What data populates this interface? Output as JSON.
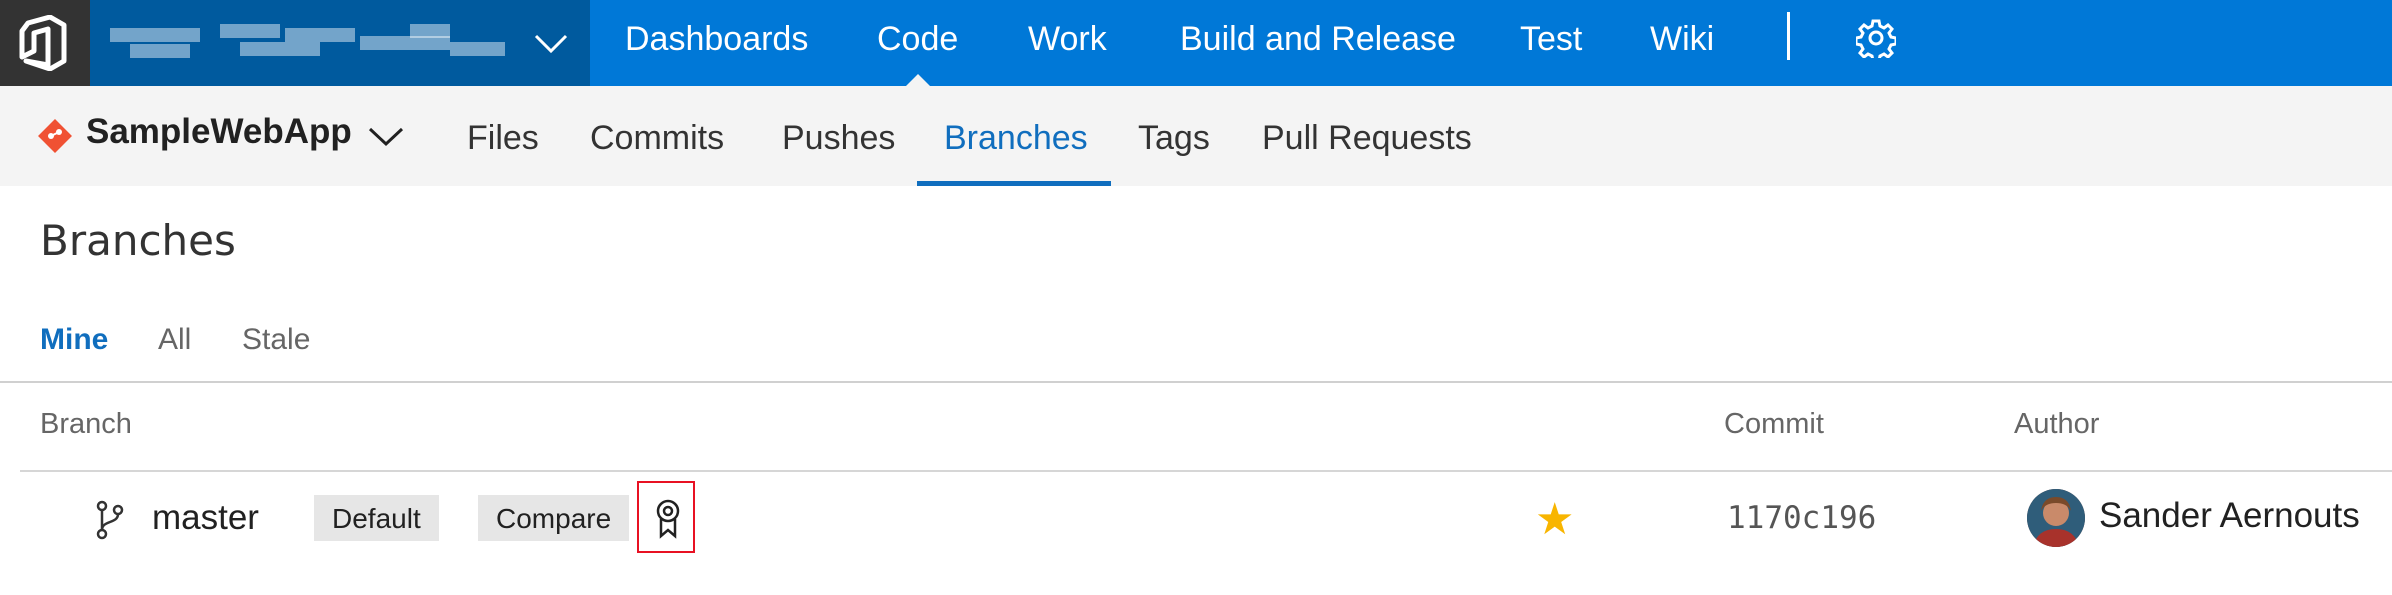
{
  "top_nav": {
    "account_name": "",
    "items": [
      {
        "label": "Dashboards",
        "active": false
      },
      {
        "label": "Code",
        "active": true
      },
      {
        "label": "Work",
        "active": false
      },
      {
        "label": "Build and Release",
        "active": false
      },
      {
        "label": "Test",
        "active": false
      },
      {
        "label": "Wiki",
        "active": false
      }
    ],
    "icons": [
      "vsts-logo-icon",
      "chevron-down-icon",
      "gear-icon"
    ]
  },
  "repo": {
    "name": "SampleWebApp",
    "icon": "git-repo-icon"
  },
  "sub_nav": {
    "tabs": [
      {
        "label": "Files",
        "active": false
      },
      {
        "label": "Commits",
        "active": false
      },
      {
        "label": "Pushes",
        "active": false
      },
      {
        "label": "Branches",
        "active": true
      },
      {
        "label": "Tags",
        "active": false
      },
      {
        "label": "Pull Requests",
        "active": false
      }
    ]
  },
  "page": {
    "title": "Branches",
    "filters": [
      {
        "label": "Mine",
        "active": true
      },
      {
        "label": "All",
        "active": false
      },
      {
        "label": "Stale",
        "active": false
      }
    ],
    "columns": {
      "branch": "Branch",
      "commit": "Commit",
      "author": "Author"
    },
    "rows": [
      {
        "branch": "master",
        "default_label": "Default",
        "compare_label": "Compare",
        "policy_icon": "branch-policy-icon",
        "favorite": true,
        "commit": "1170c196",
        "author": "Sander Aernouts"
      }
    ]
  },
  "colors": {
    "top_bar": "#0078d7",
    "account_bg": "#005a9e",
    "accent": "#106ebe",
    "star": "#f8b500",
    "highlight_box": "#e81123"
  }
}
